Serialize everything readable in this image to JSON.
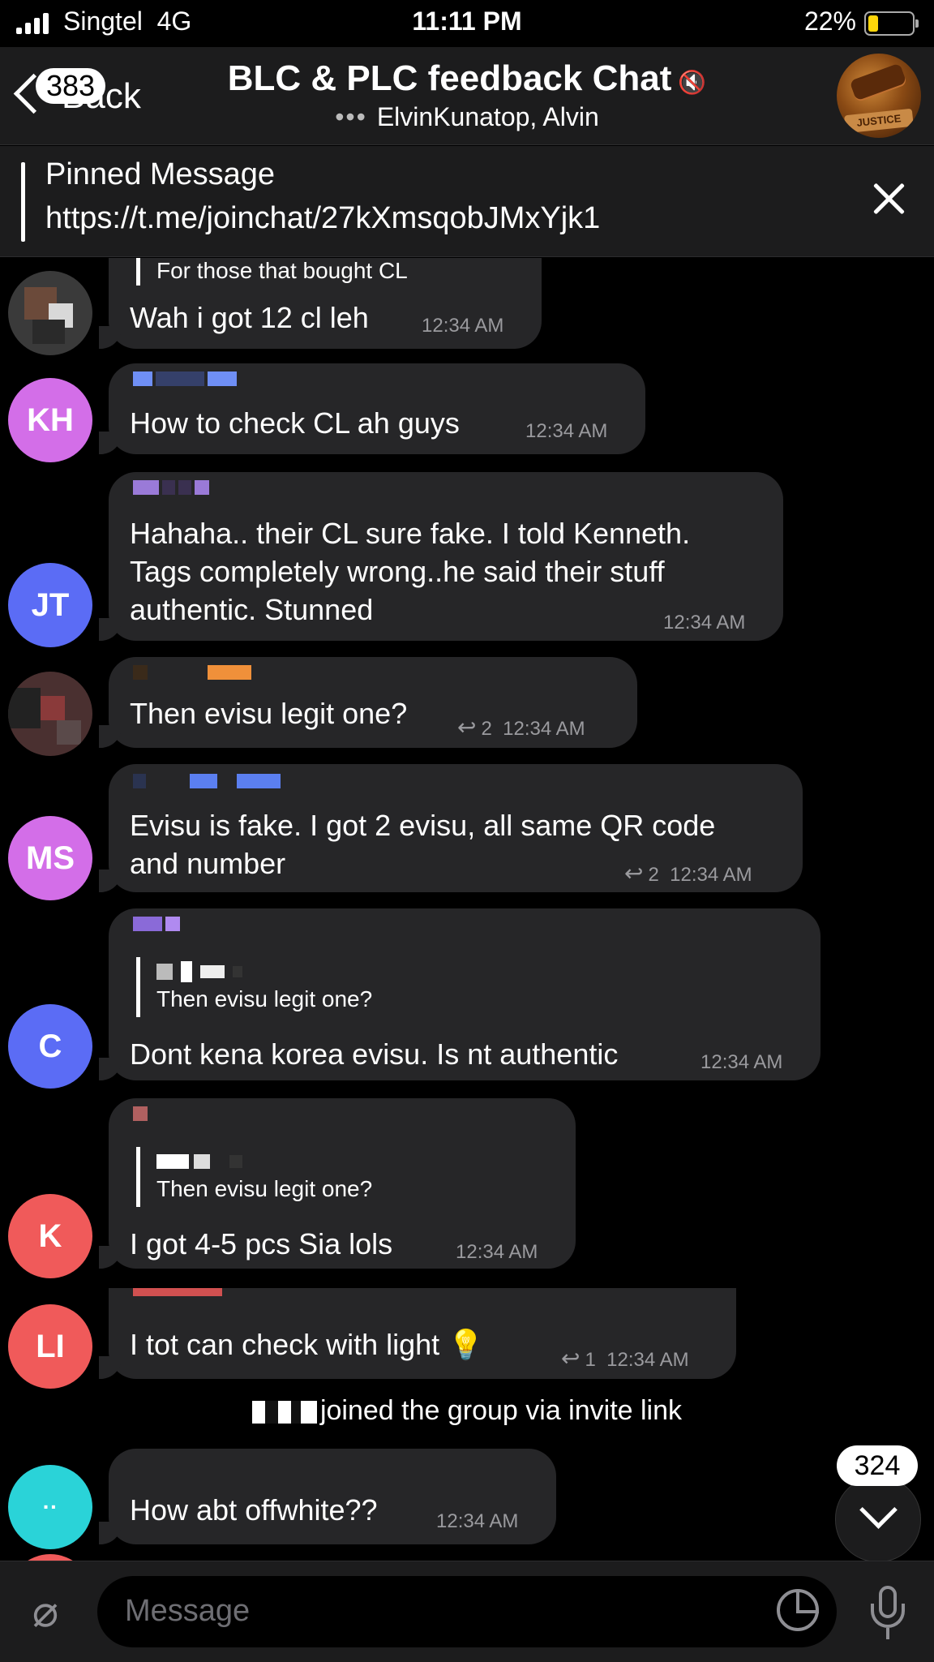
{
  "status_bar": {
    "carrier": "Singtel",
    "network": "4G",
    "time": "11:11 PM",
    "battery": "22%"
  },
  "header": {
    "back_label": "Back",
    "unread_count": "383",
    "title": "BLC & PLC feedback Chat",
    "typing_indicator": "•••",
    "subtitle": "ElvinKunatop, Alvin",
    "avatar_label": "JUSTICE"
  },
  "pinned": {
    "title": "Pinned Message",
    "text": "https://t.me/joinchat/27kXmsqobJMxYjk1"
  },
  "messages": [
    {
      "initials": "",
      "avatar_color": "#3a3a3a",
      "quote": "For those that bought CL",
      "text": "Wah i got 12 cl leh",
      "time": "12:34 AM"
    },
    {
      "initials": "KH",
      "avatar_color": "#d36ee8",
      "text": "How to check CL ah guys",
      "time": "12:34 AM"
    },
    {
      "initials": "JT",
      "avatar_color": "#5b6cf5",
      "text_lines": [
        "Hahaha.. their CL sure fake. I told Kenneth.",
        "Tags completely wrong..he said their stuff",
        "authentic. Stunned"
      ],
      "time": "12:34 AM"
    },
    {
      "initials": "",
      "avatar_color": "#4a3030",
      "text": "Then evisu legit one?",
      "replies": "2",
      "time": "12:34 AM"
    },
    {
      "initials": "MS",
      "avatar_color": "#d36ee8",
      "text_lines": [
        "Evisu is fake. I got 2 evisu, all same QR code",
        "and number"
      ],
      "replies": "2",
      "time": "12:34 AM"
    },
    {
      "initials": "C",
      "avatar_color": "#5b6cf5",
      "quote": "Then evisu legit one?",
      "text": "Dont kena korea evisu. Is nt authentic",
      "time": "12:34 AM"
    },
    {
      "initials": "K",
      "avatar_color": "#f05a5a",
      "quote": "Then evisu legit one?",
      "text": "I got 4-5 pcs Sia lols",
      "time": "12:34 AM"
    },
    {
      "initials": "LI",
      "avatar_color": "#f05a5a",
      "text": "I tot can check with light",
      "emoji": "💡",
      "replies": "1",
      "time": "12:34 AM"
    },
    {
      "initials": "··",
      "avatar_color": "#2ad3d8",
      "text": "How abt offwhite??",
      "time": "12:34 AM"
    }
  ],
  "service_message": "joined the group via invite link",
  "scroll_down_count": "324",
  "input": {
    "placeholder": "Message"
  }
}
